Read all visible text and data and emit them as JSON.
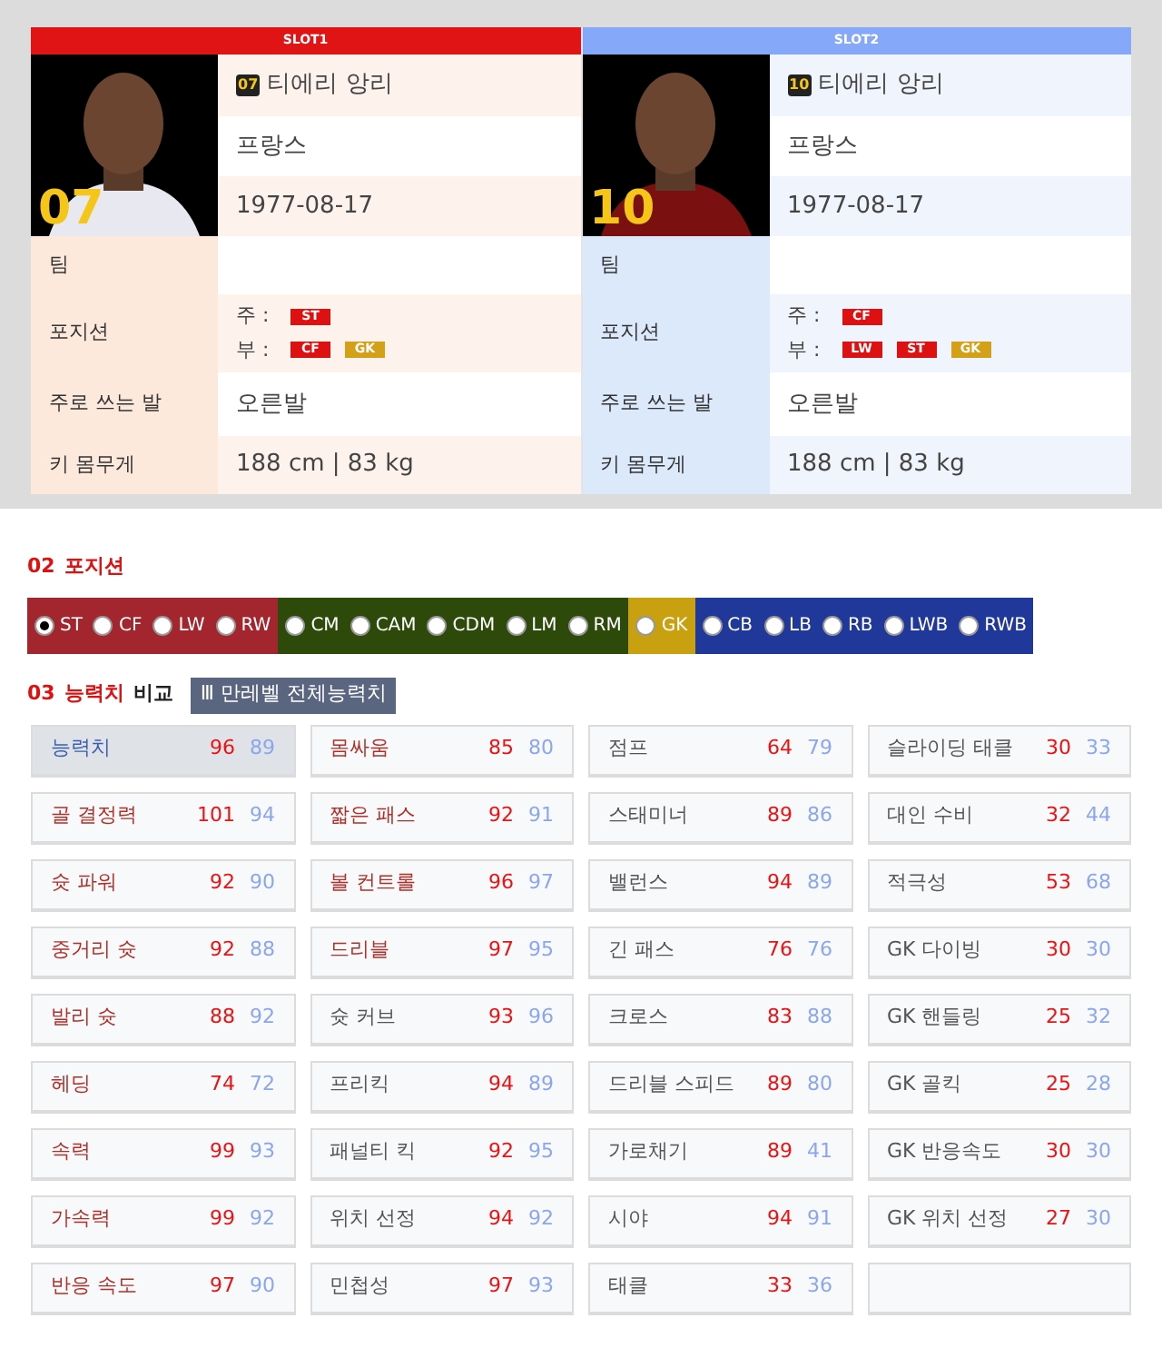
{
  "slots": [
    {
      "header": "SLOT1",
      "jersey_number": "07",
      "number": "07",
      "name": "티에리 앙리",
      "country": "프랑스",
      "birth": "1977-08-17",
      "labels": {
        "team": "팀",
        "position": "포지션",
        "foot": "주로 쓰는 발",
        "size": "키 몸무게"
      },
      "main_label": "주 :",
      "sub_label": "부 :",
      "main_positions": [
        {
          "label": "ST",
          "color": "#dd1111"
        }
      ],
      "sub_positions": [
        {
          "label": "CF",
          "color": "#dd1111"
        },
        {
          "label": "GK",
          "color": "#d4a017"
        }
      ],
      "foot": "오른발",
      "size": "188 cm | 83 kg"
    },
    {
      "header": "SLOT2",
      "jersey_number": "10",
      "number": "10",
      "name": "티에리 앙리",
      "country": "프랑스",
      "birth": "1977-08-17",
      "labels": {
        "team": "팀",
        "position": "포지션",
        "foot": "주로 쓰는 발",
        "size": "키 몸무게"
      },
      "main_label": "주 :",
      "sub_label": "부 :",
      "main_positions": [
        {
          "label": "CF",
          "color": "#dd1111"
        }
      ],
      "sub_positions": [
        {
          "label": "LW",
          "color": "#dd1111"
        },
        {
          "label": "ST",
          "color": "#dd1111"
        },
        {
          "label": "GK",
          "color": "#d4a017"
        }
      ],
      "foot": "오른발",
      "size": "188 cm | 83 kg"
    }
  ],
  "position_section": {
    "number": "02",
    "title": "포지션",
    "groups": [
      {
        "color": "#a3262e",
        "items": [
          {
            "label": "ST",
            "selected": true
          },
          {
            "label": "CF",
            "selected": false
          },
          {
            "label": "LW",
            "selected": false
          },
          {
            "label": "RW",
            "selected": false
          }
        ]
      },
      {
        "color": "#2e4a0b",
        "items": [
          {
            "label": "CM",
            "selected": false
          },
          {
            "label": "CAM",
            "selected": false
          },
          {
            "label": "CDM",
            "selected": false
          },
          {
            "label": "LM",
            "selected": false
          },
          {
            "label": "RM",
            "selected": false
          }
        ]
      },
      {
        "color": "#c8a010",
        "items": [
          {
            "label": "GK",
            "selected": false
          }
        ]
      },
      {
        "color": "#1f3899",
        "items": [
          {
            "label": "CB",
            "selected": false
          },
          {
            "label": "LB",
            "selected": false
          },
          {
            "label": "RB",
            "selected": false
          },
          {
            "label": "LWB",
            "selected": false
          },
          {
            "label": "RWB",
            "selected": false
          }
        ]
      }
    ]
  },
  "stats_section": {
    "number": "03",
    "title": "능력치",
    "suffix": "비교",
    "button": "Ⅲ 만레벨 전체능력치",
    "columns": [
      [
        {
          "label": "능력치",
          "a": "96",
          "b": "89",
          "selected": true
        },
        {
          "label": "골 결정력",
          "a": "101",
          "b": "94",
          "selected": false,
          "highlighted": true
        },
        {
          "label": "슛 파워",
          "a": "92",
          "b": "90",
          "selected": false,
          "highlighted": true
        },
        {
          "label": "중거리 슛",
          "a": "92",
          "b": "88",
          "selected": false,
          "highlighted": true
        },
        {
          "label": "발리 슛",
          "a": "88",
          "b": "92",
          "selected": false,
          "highlighted": true
        },
        {
          "label": "헤딩",
          "a": "74",
          "b": "72",
          "selected": false,
          "highlighted": true
        },
        {
          "label": "속력",
          "a": "99",
          "b": "93",
          "selected": false,
          "highlighted": true
        },
        {
          "label": "가속력",
          "a": "99",
          "b": "92",
          "selected": false,
          "highlighted": true
        },
        {
          "label": "반응 속도",
          "a": "97",
          "b": "90",
          "selected": false,
          "highlighted": true
        }
      ],
      [
        {
          "label": "몸싸움",
          "a": "85",
          "b": "80",
          "selected": false,
          "highlighted": true
        },
        {
          "label": "짧은 패스",
          "a": "92",
          "b": "91",
          "selected": false,
          "highlighted": true
        },
        {
          "label": "볼 컨트롤",
          "a": "96",
          "b": "97",
          "selected": false,
          "highlighted": true
        },
        {
          "label": "드리블",
          "a": "97",
          "b": "95",
          "selected": false,
          "highlighted": true
        },
        {
          "label": "슛 커브",
          "a": "93",
          "b": "96",
          "selected": false,
          "highlighted": false
        },
        {
          "label": "프리킥",
          "a": "94",
          "b": "89",
          "selected": false,
          "highlighted": false
        },
        {
          "label": "패널티 킥",
          "a": "92",
          "b": "95",
          "selected": false,
          "highlighted": false
        },
        {
          "label": "위치 선정",
          "a": "94",
          "b": "92",
          "selected": false,
          "highlighted": false
        },
        {
          "label": "민첩성",
          "a": "97",
          "b": "93",
          "selected": false,
          "highlighted": false
        }
      ],
      [
        {
          "label": "점프",
          "a": "64",
          "b": "79",
          "selected": false,
          "highlighted": false
        },
        {
          "label": "스태미너",
          "a": "89",
          "b": "86",
          "selected": false,
          "highlighted": false
        },
        {
          "label": "밸런스",
          "a": "94",
          "b": "89",
          "selected": false,
          "highlighted": false
        },
        {
          "label": "긴 패스",
          "a": "76",
          "b": "76",
          "selected": false,
          "highlighted": false
        },
        {
          "label": "크로스",
          "a": "83",
          "b": "88",
          "selected": false,
          "highlighted": false
        },
        {
          "label": "드리블 스피드",
          "a": "89",
          "b": "80",
          "selected": false,
          "highlighted": false
        },
        {
          "label": "가로채기",
          "a": "89",
          "b": "41",
          "selected": false,
          "highlighted": false
        },
        {
          "label": "시야",
          "a": "94",
          "b": "91",
          "selected": false,
          "highlighted": false
        },
        {
          "label": "태클",
          "a": "33",
          "b": "36",
          "selected": false,
          "highlighted": false
        }
      ],
      [
        {
          "label": "슬라이딩 태클",
          "a": "30",
          "b": "33",
          "selected": false,
          "highlighted": false
        },
        {
          "label": "대인 수비",
          "a": "32",
          "b": "44",
          "selected": false,
          "highlighted": false
        },
        {
          "label": "적극성",
          "a": "53",
          "b": "68",
          "selected": false,
          "highlighted": false
        },
        {
          "label": "GK 다이빙",
          "a": "30",
          "b": "30",
          "selected": false,
          "highlighted": false
        },
        {
          "label": "GK 핸들링",
          "a": "25",
          "b": "32",
          "selected": false,
          "highlighted": false
        },
        {
          "label": "GK 골킥",
          "a": "25",
          "b": "28",
          "selected": false,
          "highlighted": false
        },
        {
          "label": "GK 반응속도",
          "a": "30",
          "b": "30",
          "selected": false,
          "highlighted": false
        },
        {
          "label": "GK 위치 선정",
          "a": "27",
          "b": "30",
          "selected": false,
          "highlighted": false
        }
      ]
    ]
  }
}
